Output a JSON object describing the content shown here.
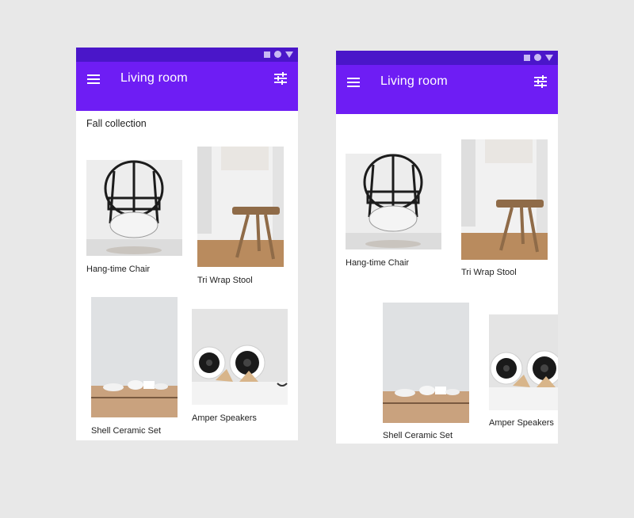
{
  "colors": {
    "status_bar": "#4a16c9",
    "app_bar": "#6e1df4",
    "background": "#e8e8e8",
    "surface": "#ffffff"
  },
  "screens": [
    {
      "app_bar": {
        "menu_icon": "menu-icon",
        "title": "Living room",
        "filter_icon": "tune-icon"
      },
      "section_title": "Fall collection",
      "products": [
        {
          "name": "Hang-time Chair",
          "image": "hanging chair photo"
        },
        {
          "name": "Tri Wrap Stool",
          "image": "wooden stool photo"
        },
        {
          "name": "Shell Ceramic Set",
          "image": "ceramic dishes photo"
        },
        {
          "name": "Amper Speakers",
          "image": "speakers photo"
        }
      ]
    },
    {
      "app_bar": {
        "menu_icon": "menu-icon",
        "title": "Living room",
        "filter_icon": "tune-icon"
      },
      "products": [
        {
          "name": "Hang-time Chair",
          "image": "hanging chair photo"
        },
        {
          "name": "Tri Wrap Stool",
          "image": "wooden stool photo"
        },
        {
          "name": "Shell Ceramic Set",
          "image": "ceramic dishes photo"
        },
        {
          "name": "Amper Speakers",
          "image": "speakers photo"
        }
      ]
    }
  ]
}
